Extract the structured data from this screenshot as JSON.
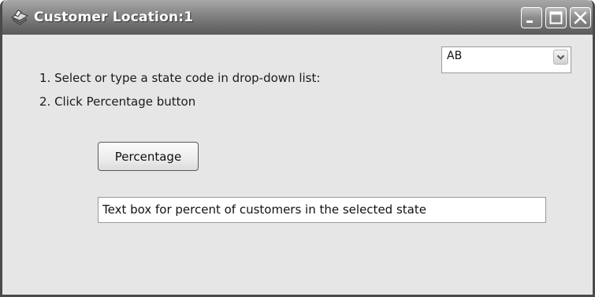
{
  "window": {
    "title": "Customer Location:1",
    "controls": {
      "minimize": "minimize-icon",
      "maximize": "maximize-icon",
      "close": "close-icon"
    },
    "app_icon": "app-icon"
  },
  "instructions": [
    "1. Select or type a state code in drop-down list:",
    "2. Click Percentage button"
  ],
  "state_combo": {
    "value": "AB",
    "arrow_icon": "chevron-down-icon"
  },
  "percentage_button": {
    "label": "Percentage"
  },
  "result_box": {
    "value": "Text box for percent of customers in the selected state"
  },
  "colors": {
    "titlebar": "#7a7a7a",
    "client_bg": "#e6e6e6",
    "field_bg": "#ffffff"
  }
}
